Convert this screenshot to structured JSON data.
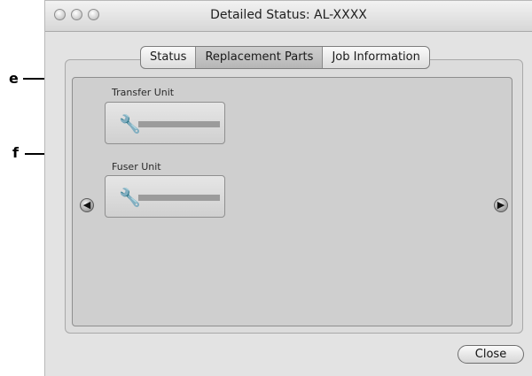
{
  "window": {
    "title": "Detailed Status: AL-XXXX"
  },
  "tabs": [
    {
      "label": "Status",
      "selected": false
    },
    {
      "label": "Replacement Parts",
      "selected": true
    },
    {
      "label": "Job Information",
      "selected": false
    }
  ],
  "parts": [
    {
      "label": "Transfer Unit",
      "icon": "wrench-icon"
    },
    {
      "label": "Fuser Unit",
      "icon": "wrench-icon"
    }
  ],
  "callouts": [
    "e",
    "f"
  ],
  "nav": {
    "prev_icon": "left-arrow-icon",
    "next_icon": "right-arrow-icon"
  },
  "buttons": {
    "close_label": "Close"
  },
  "colors": {
    "window_bg": "#e3e3e3",
    "panel_bg": "#cfcfcf",
    "meter": "#9b9b9b"
  }
}
